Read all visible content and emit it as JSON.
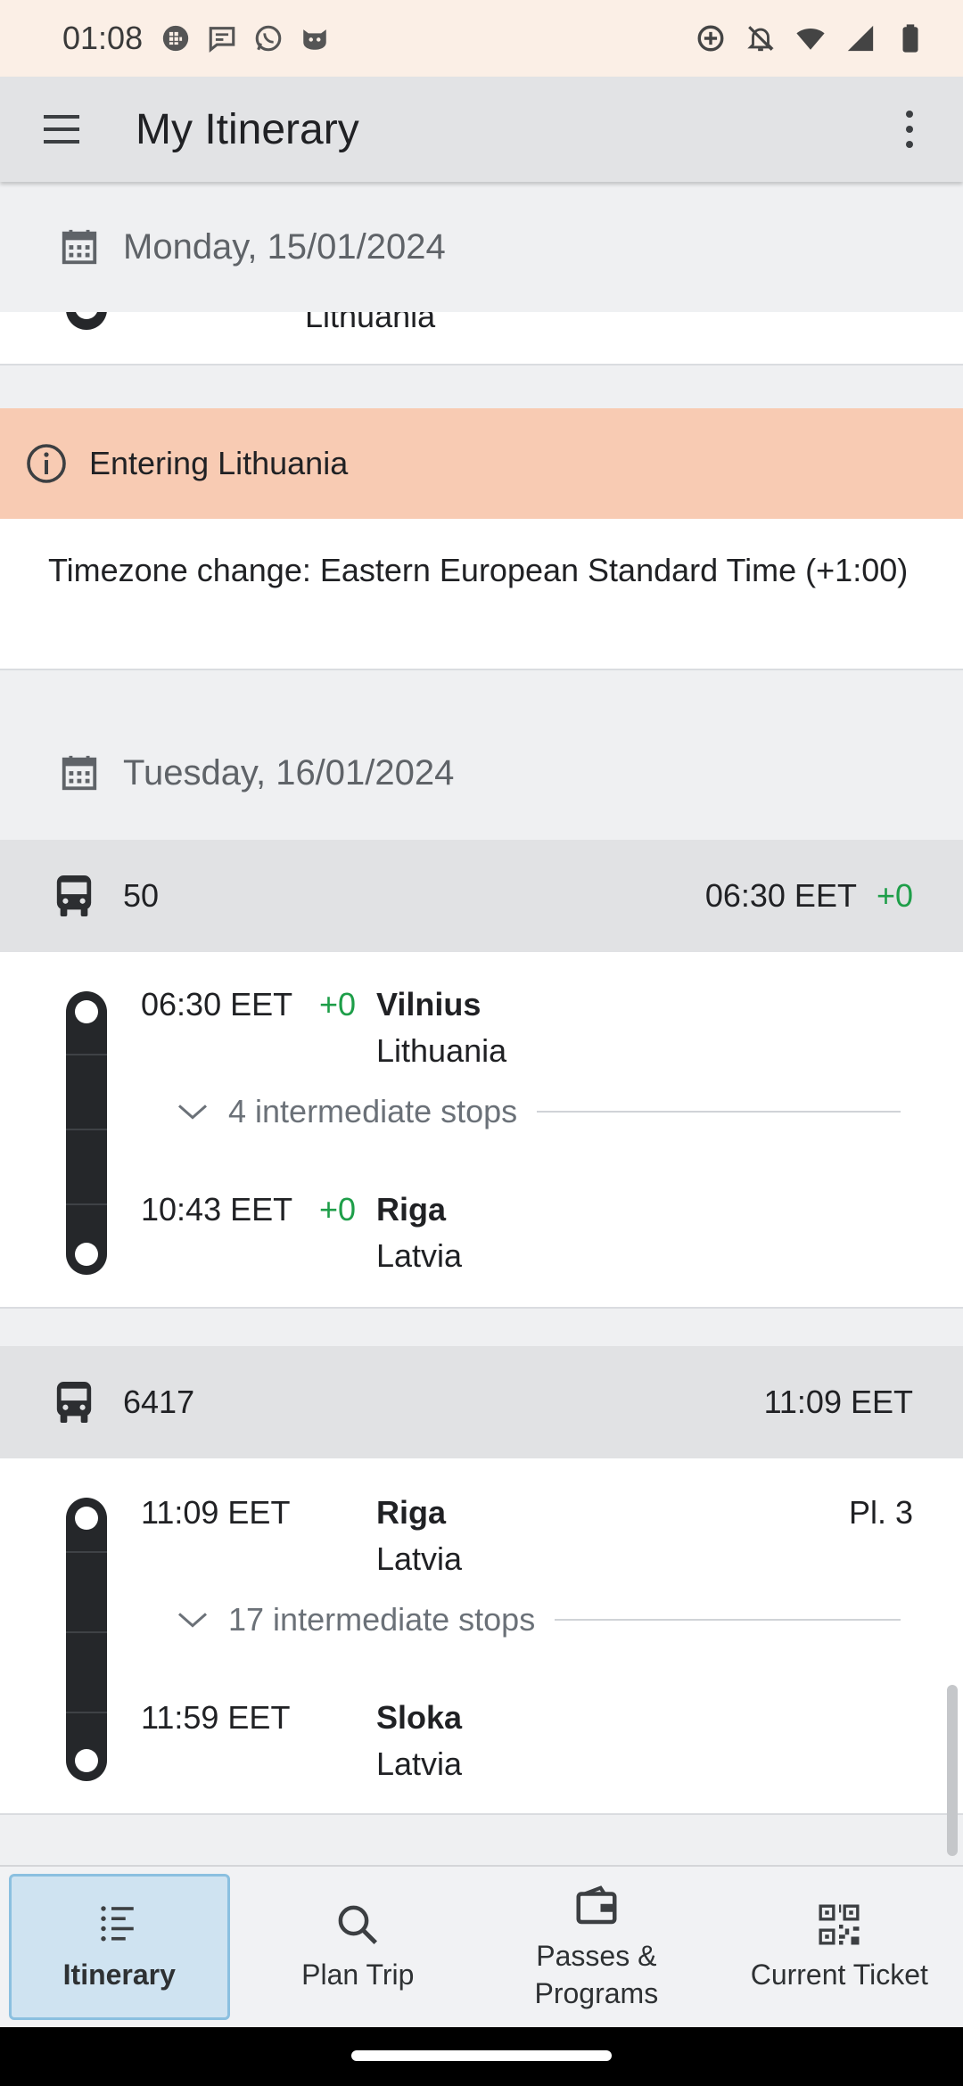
{
  "status_bar": {
    "time": "01:08",
    "left_icons": [
      "grid-app-icon",
      "message-app-icon",
      "whatsapp-icon",
      "cat-app-icon"
    ],
    "right_icons": [
      "data-saver-icon",
      "do-not-disturb-icon",
      "wifi-icon",
      "signal-icon",
      "battery-icon"
    ]
  },
  "app_bar": {
    "title": "My Itinerary"
  },
  "itinerary": {
    "day1": {
      "date": "Monday, 15/01/2024",
      "partial_stop_country": "Lithuania"
    },
    "notice": {
      "title": "Entering Lithuania",
      "body": "Timezone change: Eastern European Standard Time (+1:00)"
    },
    "day2": {
      "date": "Tuesday, 16/01/2024"
    },
    "legs": [
      {
        "number": "50",
        "departure": "06:30 EET",
        "delay": "+0",
        "stops": [
          {
            "time": "06:30 EET",
            "delay": "+0",
            "name": "Vilnius",
            "country": "Lithuania",
            "platform": ""
          },
          {
            "time": "10:43 EET",
            "delay": "+0",
            "name": "Riga",
            "country": "Latvia",
            "platform": ""
          }
        ],
        "intermediate": "4 intermediate stops"
      },
      {
        "number": "6417",
        "departure": "11:09 EET",
        "delay": "",
        "stops": [
          {
            "time": "11:09 EET",
            "delay": "",
            "name": "Riga",
            "country": "Latvia",
            "platform": "Pl. 3"
          },
          {
            "time": "11:59 EET",
            "delay": "",
            "name": "Sloka",
            "country": "Latvia",
            "platform": ""
          }
        ],
        "intermediate": "17 intermediate stops"
      }
    ]
  },
  "bottom_nav": {
    "items": [
      {
        "label": "Itinerary",
        "icon": "list-icon",
        "active": true
      },
      {
        "label": "Plan Trip",
        "icon": "search-icon",
        "active": false
      },
      {
        "label": "Passes & Programs",
        "icon": "wallet-icon",
        "active": false
      },
      {
        "label": "Current Ticket",
        "icon": "qr-code-icon",
        "active": false
      }
    ]
  },
  "colors": {
    "status_bar_bg": "#fbefe6",
    "app_bar_bg": "#e2e3e5",
    "notice_bg": "#f8cbb3",
    "delay_green": "#1e9e49",
    "active_nav_bg": "#cfe3f1"
  }
}
